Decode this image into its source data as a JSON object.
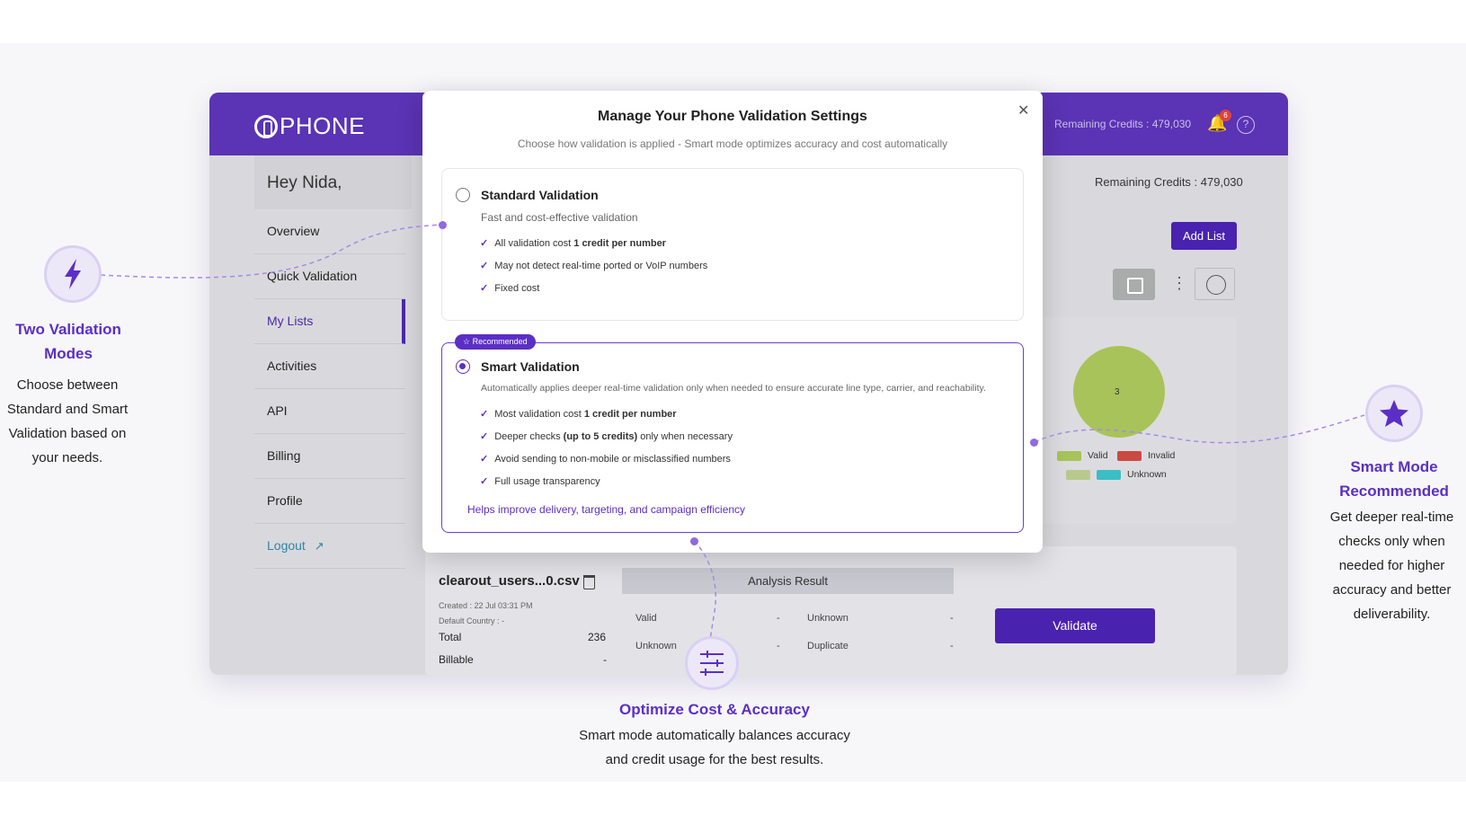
{
  "app": {
    "logo": "PHONE",
    "header_credits": "Remaining Credits : 479,030",
    "notification_count": "6",
    "greeting": "Hey Nida,",
    "main_credits": "Remaining Credits : 479,030",
    "add_list_label": "Add List",
    "nav": [
      "Overview",
      "Quick Validation",
      "My Lists",
      "Activities",
      "API",
      "Billing",
      "Profile",
      "Logout"
    ],
    "active_nav": "My Lists"
  },
  "modal": {
    "title": "Manage Your Phone Validation Settings",
    "subtitle": "Choose how validation is applied - Smart mode optimizes accuracy and cost automatically",
    "standard": {
      "title": "Standard Validation",
      "desc": "Fast and cost-effective validation",
      "items": [
        {
          "pre": "All validation cost ",
          "bold": "1 credit per number",
          "post": ""
        },
        {
          "pre": "May not detect real-time ported or VoIP numbers",
          "bold": "",
          "post": ""
        },
        {
          "pre": "Fixed cost",
          "bold": "",
          "post": ""
        }
      ]
    },
    "smart": {
      "badge": "Recommended",
      "title": "Smart Validation",
      "desc": "Automatically applies deeper real-time validation only when needed to ensure accurate line type, carrier, and reachability.",
      "items": [
        {
          "pre": "Most validation cost ",
          "bold": "1 credit per number",
          "post": ""
        },
        {
          "pre": "Deeper checks ",
          "bold": "(up to 5 credits)",
          "post": " only when necessary"
        },
        {
          "pre": "Avoid sending to non-mobile or misclassified numbers",
          "bold": "",
          "post": ""
        },
        {
          "pre": "Full usage transparency",
          "bold": "",
          "post": ""
        }
      ],
      "footer": "Helps improve delivery, targeting, and campaign efficiency"
    }
  },
  "file": {
    "name": "clearout_users...0.csv",
    "created": "Created : 22 Jul 03:31 PM",
    "country": "Default Country : -",
    "total_label": "Total",
    "total_value": "236",
    "billable_label": "Billable",
    "billable_value": "-",
    "analysis_title": "Analysis Result",
    "analysis": [
      {
        "label": "Valid",
        "value": "-"
      },
      {
        "label": "Unknown",
        "value": "-"
      },
      {
        "label": "Unknown",
        "value": "-"
      },
      {
        "label": "Duplicate",
        "value": "-"
      }
    ],
    "validate_label": "Validate"
  },
  "chart_data": {
    "type": "pie",
    "slices": [
      {
        "name": "Valid",
        "value": 3
      }
    ],
    "label": "3",
    "legend": [
      {
        "name": "Valid",
        "color": "#a8c35a"
      },
      {
        "name": "Invalid",
        "color": "#c94a44"
      },
      {
        "name": "",
        "color": "#b9c98e"
      },
      {
        "name": "Unknown",
        "color": "#3bbec4"
      }
    ]
  },
  "callouts": {
    "left": {
      "title_line1": "Two Validation",
      "title_line2": "Modes",
      "body": [
        "Choose between",
        "Standard and Smart",
        "Validation based on",
        "your needs."
      ]
    },
    "right": {
      "title_line1": "Smart Mode",
      "title_line2": "Recommended",
      "body": [
        "Get deeper real-time",
        "checks only when",
        "needed for higher",
        "accuracy and better",
        "deliverability."
      ]
    },
    "bottom": {
      "title": "Optimize Cost & Accuracy",
      "body": [
        "Smart mode automatically balances accuracy",
        "and credit usage for the best results."
      ]
    }
  },
  "colors": {
    "brand": "#5b33b5",
    "accent": "#5b2fc5",
    "valid": "#a8c35a",
    "invalid": "#c94a44",
    "unknown": "#3bbec4"
  },
  "icons": {
    "left": "lightning-icon",
    "right": "star-icon",
    "bottom": "sliders-icon"
  }
}
